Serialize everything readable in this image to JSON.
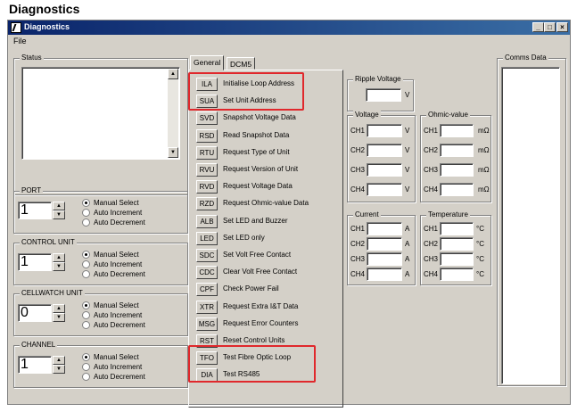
{
  "doc_title": "Diagnostics",
  "window": {
    "title": "Diagnostics",
    "controls": {
      "minimize": "_",
      "maximize": "□",
      "close": "×"
    }
  },
  "menu": {
    "file": "File"
  },
  "status": {
    "label": "Status"
  },
  "port": {
    "label": "PORT",
    "value": "1"
  },
  "control_unit": {
    "label": "CONTROL UNIT",
    "value": "1"
  },
  "cellwatch_unit": {
    "label": "CELLWATCH UNIT",
    "value": "0"
  },
  "channel": {
    "label": "CHANNEL",
    "value": "1"
  },
  "radio_options": {
    "manual": "Manual Select",
    "inc": "Auto Increment",
    "dec": "Auto Decrement"
  },
  "tabs": {
    "general": "General",
    "dcm5": "DCM5"
  },
  "commands": [
    {
      "code": "ILA",
      "label": "Initialise Loop Address"
    },
    {
      "code": "SUA",
      "label": "Set Unit Address"
    },
    {
      "code": "SVD",
      "label": "Snapshot Voltage Data"
    },
    {
      "code": "RSD",
      "label": "Read Snapshot Data"
    },
    {
      "code": "RTU",
      "label": "Request Type of Unit"
    },
    {
      "code": "RVU",
      "label": "Request Version of Unit"
    },
    {
      "code": "RVD",
      "label": "Request Voltage Data"
    },
    {
      "code": "RZD",
      "label": "Request Ohmic-value Data"
    },
    {
      "code": "ALB",
      "label": "Set LED and Buzzer"
    },
    {
      "code": "LED",
      "label": "Set LED only"
    },
    {
      "code": "SDC",
      "label": "Set Volt Free Contact"
    },
    {
      "code": "CDC",
      "label": "Clear Volt Free Contact"
    },
    {
      "code": "CPF",
      "label": "Check Power Fail"
    },
    {
      "code": "XTR",
      "label": "Request Extra I&T Data"
    },
    {
      "code": "MSG",
      "label": "Request Error Counters"
    },
    {
      "code": "RST",
      "label": "Reset Control Units"
    },
    {
      "code": "TFO",
      "label": "Test Fibre Optic Loop"
    },
    {
      "code": "DIA",
      "label": "Test RS485"
    }
  ],
  "ripple": {
    "label": "Ripple Voltage",
    "unit": "V"
  },
  "voltage": {
    "label": "Voltage",
    "unit": "V"
  },
  "ohmic": {
    "label": "Ohmic-value",
    "unit": "mΩ"
  },
  "current": {
    "label": "Current",
    "unit": "A"
  },
  "temperature": {
    "label": "Temperature",
    "unit": "°C"
  },
  "channels": [
    "CH1",
    "CH2",
    "CH3",
    "CH4"
  ],
  "comms": {
    "label": "Comms Data"
  }
}
